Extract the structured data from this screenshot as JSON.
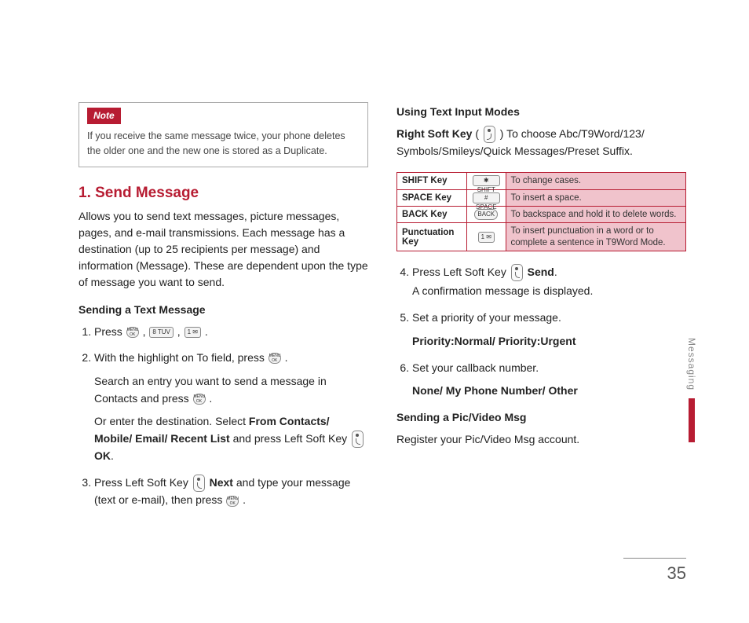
{
  "sidebar": {
    "label": "Messaging"
  },
  "pageNumber": "35",
  "note": {
    "tag": "Note",
    "text": "If you receive the same message twice, your phone deletes the older one and the new one is stored as a Duplicate."
  },
  "section1": {
    "heading": "1. Send Message",
    "intro": "Allows you to send text messages, picture messages, pages, and e-mail transmissions. Each message has a destination (up to 25 recipients per message) and information (Message). These are dependent upon the type of message you want to send.",
    "sub1": "Sending a Text Message",
    "step1_a": "Press ",
    "step1_b": " , ",
    "step1_c": " , ",
    "step1_d": " .",
    "step2_a": "With the highlight on To field, press ",
    "step2_b": " .",
    "step2_sub1_a": "Search an entry you want to send a message in Contacts and press ",
    "step2_sub1_b": " .",
    "step2_sub2_a": "Or enter the destination. Select ",
    "step2_sub2_bold": "From Contacts/ Mobile/ Email/ Recent List",
    "step2_sub2_b": " and press Left Soft Key ",
    "step2_sub2_ok": "OK",
    "step2_sub2_c": ".",
    "step3_a": "Press Left Soft Key ",
    "step3_bold": "Next",
    "step3_b": " and type your message (text or e-mail), then press ",
    "step3_c": " ."
  },
  "col2": {
    "sub1": "Using Text Input Modes",
    "rightsoft_a": "Right Soft Key",
    "rightsoft_b": " ( ",
    "rightsoft_c": " ) To choose Abc/T9Word/123/ Symbols/Smileys/Quick Messages/Preset Suffix.",
    "table": {
      "rows": [
        {
          "name": "SHIFT Key",
          "icon": "✱ SHIFT",
          "desc": "To change cases."
        },
        {
          "name": "SPACE Key",
          "icon": "# SPACE",
          "desc": "To insert a space."
        },
        {
          "name": "BACK Key",
          "icon": "BACK",
          "desc": "To backspace and hold it to delete words."
        },
        {
          "name": "Punctuation Key",
          "icon": "1 ✉",
          "desc": "To insert punctuation in a word or to complete a sentence in T9Word Mode."
        }
      ]
    },
    "step4_a": "Press Left Soft Key ",
    "step4_bold": "Send",
    "step4_b": ".",
    "step4_sub": "A confirmation message is displayed.",
    "step5": "Set a priority of your message.",
    "step5_bold": "Priority:Normal/ Priority:Urgent",
    "step6": "Set your callback number.",
    "step6_bold": "None/ My Phone Number/ Other",
    "sub2": "Sending a Pic/Video Msg",
    "pic_text": "Register your Pic/Video Msg account."
  },
  "icons": {
    "menuok": "MENU OK",
    "eight": "8 TUV",
    "one": "1 ✉"
  }
}
